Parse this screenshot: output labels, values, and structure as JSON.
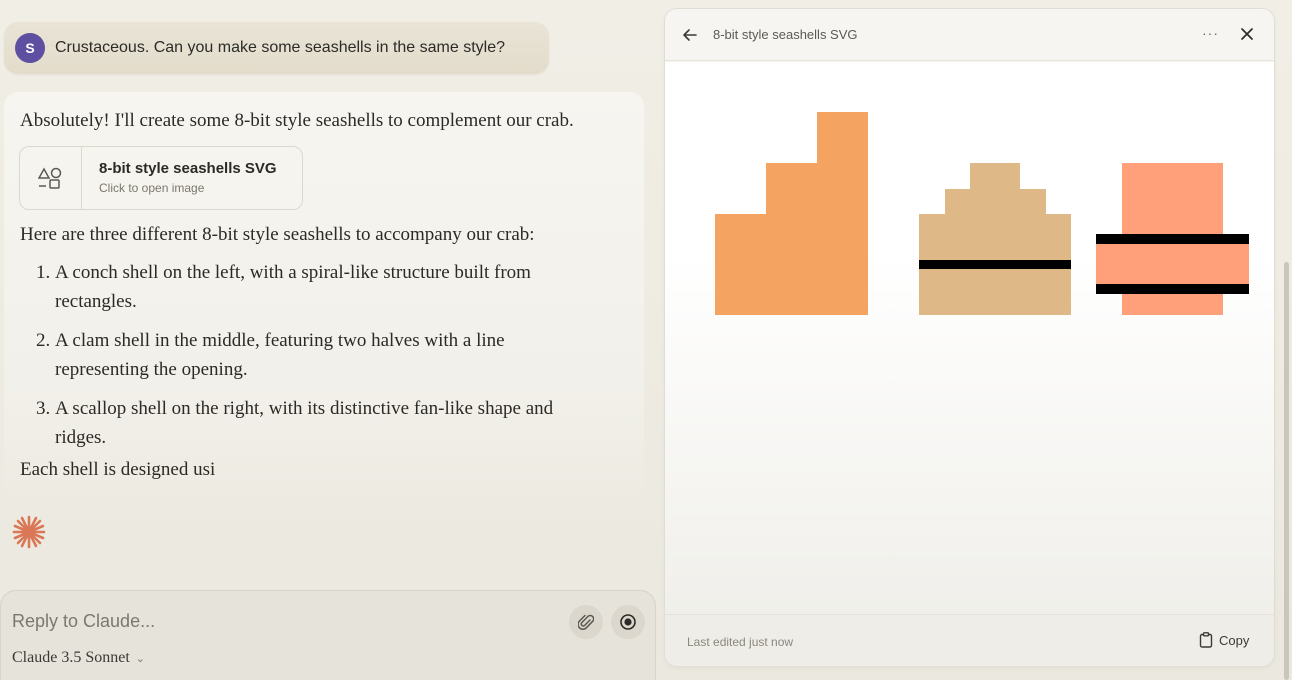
{
  "user_message": {
    "avatar_initial": "S",
    "text": "Crustaceous. Can you make some seashells in the same style?"
  },
  "assistant": {
    "intro": "Absolutely! I'll create some 8-bit style seashells to complement our crab.",
    "artifact_card": {
      "title": "8-bit style seashells SVG",
      "subtitle": "Click to open image",
      "icon": "shapes-icon"
    },
    "list_intro": "Here are three different 8-bit style seashells to accompany our crab:",
    "list_items": [
      {
        "num": "1.",
        "line1": "A conch shell on the left, with a spiral-like structure built from",
        "line2": "rectangles."
      },
      {
        "num": "2.",
        "line1": "A clam shell in the middle, featuring two halves with a line",
        "line2": "representing the opening."
      },
      {
        "num": "3.",
        "line1": "A scallop shell on the right, with its distinctive fan-like shape and",
        "line2": "ridges."
      }
    ],
    "partial_text": "Each shell is designed usi",
    "spark_color": "#d97757"
  },
  "composer": {
    "placeholder": "Reply to Claude...",
    "model": "Claude 3.5 Sonnet",
    "attach_icon": "paperclip-icon",
    "record_icon": "record-icon"
  },
  "artifact_pane": {
    "title": "8-bit style seashells SVG",
    "footer_status": "Last edited just now",
    "copy_label": "Copy",
    "colors": {
      "conch": "#f4a460",
      "clam": "#deb887",
      "scallop": "#ffa07a",
      "line": "#000000"
    }
  }
}
